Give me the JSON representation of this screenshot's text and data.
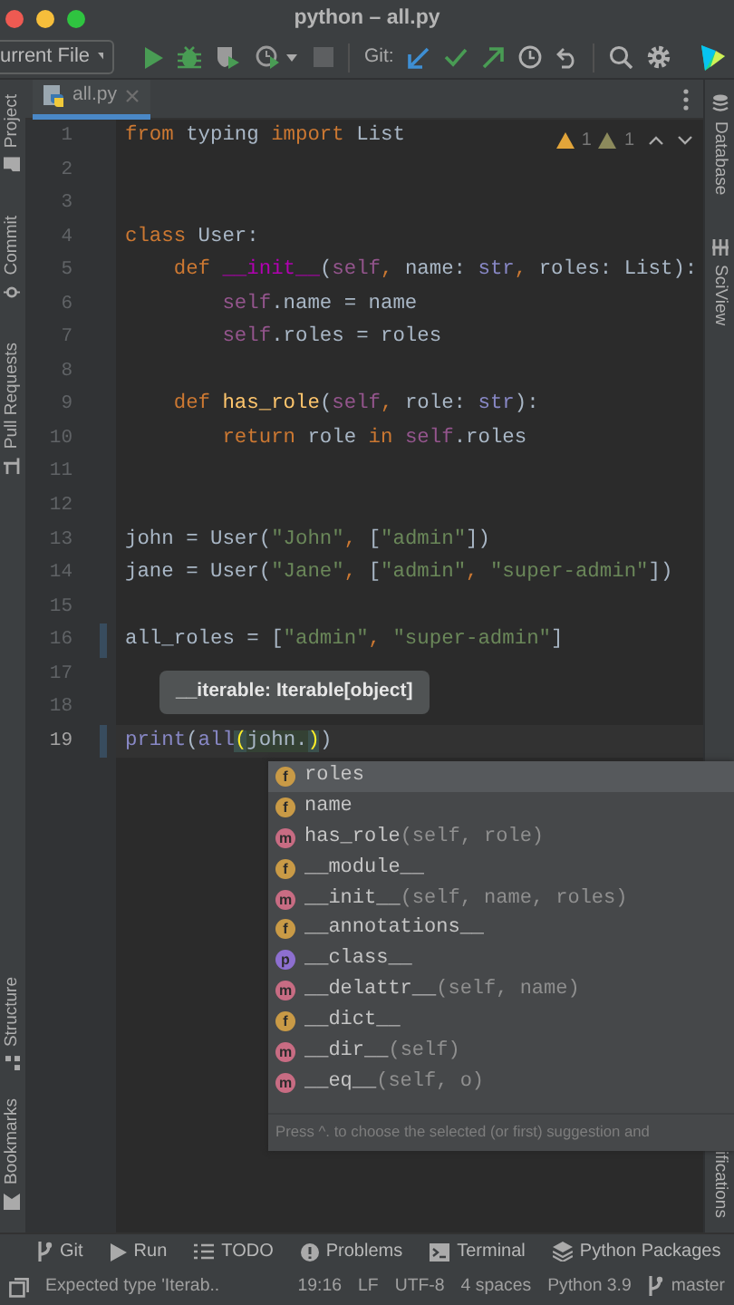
{
  "window": {
    "title": "python – all.py"
  },
  "toolbar": {
    "run_configuration": "urrent File",
    "git_label": "Git:"
  },
  "left_tool_windows_top": [
    "Project",
    "Commit",
    "Pull Requests"
  ],
  "left_tool_windows_bottom": [
    "Structure",
    "Bookmarks"
  ],
  "right_tool_windows_top": [
    "Database",
    "SciView"
  ],
  "right_tool_windows_bottom": [
    "ifications"
  ],
  "tabs": [
    {
      "label": "all.py",
      "selected": true
    }
  ],
  "editor": {
    "inspections": [
      {
        "kind": "warning",
        "count": "1"
      },
      {
        "kind": "weak-warning",
        "count": "1"
      }
    ],
    "lines": [
      {
        "number": "1",
        "current": false,
        "changed": false,
        "tokens": [
          {
            "text": "from",
            "kind": "keyword"
          },
          {
            "text": " typing ",
            "kind": "plain"
          },
          {
            "text": "import",
            "kind": "keyword"
          },
          {
            "text": " List",
            "kind": "plain"
          }
        ]
      },
      {
        "number": "2",
        "current": false,
        "changed": false
      },
      {
        "number": "3",
        "current": false,
        "changed": false
      },
      {
        "number": "4",
        "current": false,
        "changed": false,
        "tokens": [
          {
            "text": "class",
            "kind": "keyword"
          },
          {
            "text": " User:",
            "kind": "plain"
          }
        ]
      },
      {
        "number": "5",
        "current": false,
        "changed": false,
        "tokens": [
          {
            "text": "    def ",
            "kind": "keyword"
          },
          {
            "text": "__init__",
            "kind": "dunder"
          },
          {
            "text": "(",
            "kind": "plain"
          },
          {
            "text": "self",
            "kind": "self"
          },
          {
            "text": ", ",
            "kind": "keyword"
          },
          {
            "text": "name: ",
            "kind": "plain"
          },
          {
            "text": "str",
            "kind": "builtin"
          },
          {
            "text": ", ",
            "kind": "keyword"
          },
          {
            "text": "roles: List):",
            "kind": "plain"
          }
        ]
      },
      {
        "number": "6",
        "current": false,
        "changed": false,
        "tokens": [
          {
            "text": "        self",
            "kind": "self"
          },
          {
            "text": ".name = name",
            "kind": "plain"
          }
        ]
      },
      {
        "number": "7",
        "current": false,
        "changed": false,
        "tokens": [
          {
            "text": "        self",
            "kind": "self"
          },
          {
            "text": ".roles = roles",
            "kind": "plain"
          }
        ]
      },
      {
        "number": "8",
        "current": false,
        "changed": false
      },
      {
        "number": "9",
        "current": false,
        "changed": false,
        "tokens": [
          {
            "text": "    def ",
            "kind": "keyword"
          },
          {
            "text": "has_role",
            "kind": "function"
          },
          {
            "text": "(",
            "kind": "plain"
          },
          {
            "text": "self",
            "kind": "self"
          },
          {
            "text": ", ",
            "kind": "keyword"
          },
          {
            "text": "role: ",
            "kind": "plain"
          },
          {
            "text": "str",
            "kind": "builtin"
          },
          {
            "text": "):",
            "kind": "plain"
          }
        ]
      },
      {
        "number": "10",
        "current": false,
        "changed": false,
        "tokens": [
          {
            "text": "        return",
            "kind": "keyword"
          },
          {
            "text": " role ",
            "kind": "plain"
          },
          {
            "text": "in ",
            "kind": "keyword"
          },
          {
            "text": "self",
            "kind": "self"
          },
          {
            "text": ".roles",
            "kind": "plain"
          }
        ]
      },
      {
        "number": "11",
        "current": false,
        "changed": false
      },
      {
        "number": "12",
        "current": false,
        "changed": false
      },
      {
        "number": "13",
        "current": false,
        "changed": false,
        "tokens": [
          {
            "text": "john = User(",
            "kind": "plain"
          },
          {
            "text": "\"John\"",
            "kind": "string"
          },
          {
            "text": ", ",
            "kind": "keyword"
          },
          {
            "text": "[",
            "kind": "plain"
          },
          {
            "text": "\"admin\"",
            "kind": "string"
          },
          {
            "text": "])",
            "kind": "plain"
          }
        ]
      },
      {
        "number": "14",
        "current": false,
        "changed": false,
        "tokens": [
          {
            "text": "jane = User(",
            "kind": "plain"
          },
          {
            "text": "\"Jane\"",
            "kind": "string"
          },
          {
            "text": ", ",
            "kind": "keyword"
          },
          {
            "text": "[",
            "kind": "plain"
          },
          {
            "text": "\"admin\"",
            "kind": "string"
          },
          {
            "text": ", ",
            "kind": "keyword"
          },
          {
            "text": "\"super-admin\"",
            "kind": "string"
          },
          {
            "text": "])",
            "kind": "plain"
          }
        ]
      },
      {
        "number": "15",
        "current": false,
        "changed": false
      },
      {
        "number": "16",
        "current": false,
        "changed": true,
        "tokens": [
          {
            "text": "all_roles = [",
            "kind": "plain"
          },
          {
            "text": "\"admin\"",
            "kind": "string"
          },
          {
            "text": ", ",
            "kind": "keyword"
          },
          {
            "text": "\"super-admin\"",
            "kind": "string"
          },
          {
            "text": "]",
            "kind": "plain"
          }
        ]
      },
      {
        "number": "17",
        "current": false,
        "changed": false
      },
      {
        "number": "18",
        "current": false,
        "changed": false
      },
      {
        "number": "19",
        "current": true,
        "changed": true,
        "tokens": [
          {
            "text": "print",
            "kind": "builtin"
          },
          {
            "text": "(",
            "kind": "plain"
          },
          {
            "text": "all",
            "kind": "builtin"
          },
          {
            "text": "(",
            "kind": "brace-match"
          },
          {
            "text": "john.",
            "kind": "argument"
          },
          {
            "text": ")",
            "kind": "brace-match"
          },
          {
            "text": ")",
            "kind": "plain"
          }
        ]
      }
    ]
  },
  "tooltip": {
    "text": "__iterable: Iterable[object]"
  },
  "completion": {
    "items": [
      {
        "kind": "field",
        "icon_letter": "f",
        "name": "roles",
        "selected": true
      },
      {
        "kind": "field",
        "icon_letter": "f",
        "name": "name",
        "selected": false
      },
      {
        "kind": "method",
        "icon_letter": "m",
        "name": "has_role",
        "params": "(self, role)",
        "selected": false
      },
      {
        "kind": "field",
        "icon_letter": "f",
        "name": "__module__",
        "selected": false
      },
      {
        "kind": "method",
        "icon_letter": "m",
        "name": "__init__",
        "params": "(self, name, roles)",
        "selected": false
      },
      {
        "kind": "field",
        "icon_letter": "f",
        "name": "__annotations__",
        "selected": false
      },
      {
        "kind": "property",
        "icon_letter": "p",
        "name": "__class__",
        "selected": false
      },
      {
        "kind": "method",
        "icon_letter": "m",
        "name": "__delattr__",
        "params": "(self, name)",
        "selected": false
      },
      {
        "kind": "field",
        "icon_letter": "f",
        "name": "__dict__",
        "selected": false
      },
      {
        "kind": "method",
        "icon_letter": "m",
        "name": "__dir__",
        "params": "(self)",
        "selected": false
      },
      {
        "kind": "method",
        "icon_letter": "m",
        "name": "__eq__",
        "params": "(self, o)",
        "selected": false
      }
    ],
    "hint": "Press ^. to choose the selected (or first) suggestion and"
  },
  "tool_windows_bottom": [
    {
      "kind": "git",
      "label": "Git"
    },
    {
      "kind": "run",
      "label": "Run"
    },
    {
      "kind": "todo",
      "label": "TODO"
    },
    {
      "kind": "problems",
      "label": "Problems"
    },
    {
      "kind": "terminal",
      "label": "Terminal"
    },
    {
      "kind": "packages",
      "label": "Python Packages"
    }
  ],
  "status_bar": {
    "message": "Expected type 'Iterab..",
    "items": [
      "19:16",
      "LF",
      "UTF-8",
      "4 spaces",
      "Python 3.9"
    ],
    "branch": "master"
  }
}
